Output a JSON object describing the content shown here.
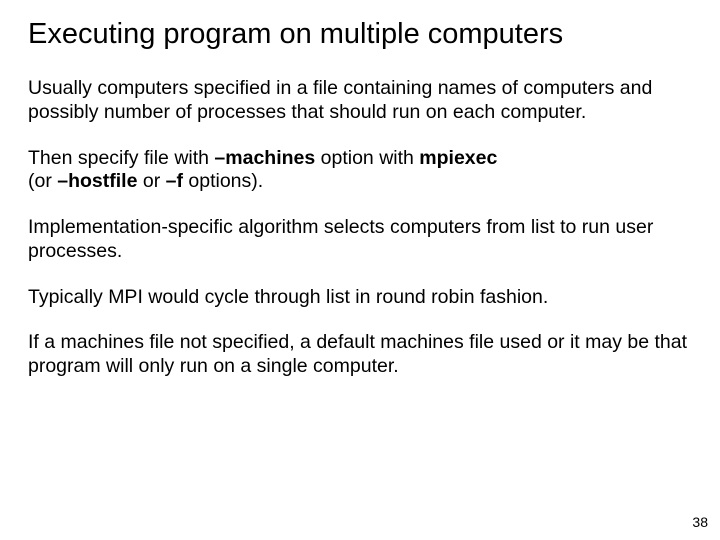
{
  "title": "Executing program on multiple computers",
  "para1": "Usually computers specified in a file containing names of computers and possibly number of processes that should run on each computer.",
  "para2": {
    "t1": "Then specify file with ",
    "opt1": "–machines",
    "t2": " option with ",
    "opt2": "mpiexec",
    "t3": "(or ",
    "opt3": "–hostfile",
    "t4": " or ",
    "opt4": "–f",
    "t5": " options)."
  },
  "para3": "Implementation-specific algorithm selects computers from list to run user processes.",
  "para4": "Typically MPI would cycle through list in round robin fashion.",
  "para5": "If a machines file not specified, a default machines file used or it may be that program will only run on a single computer.",
  "pageNum": "38"
}
